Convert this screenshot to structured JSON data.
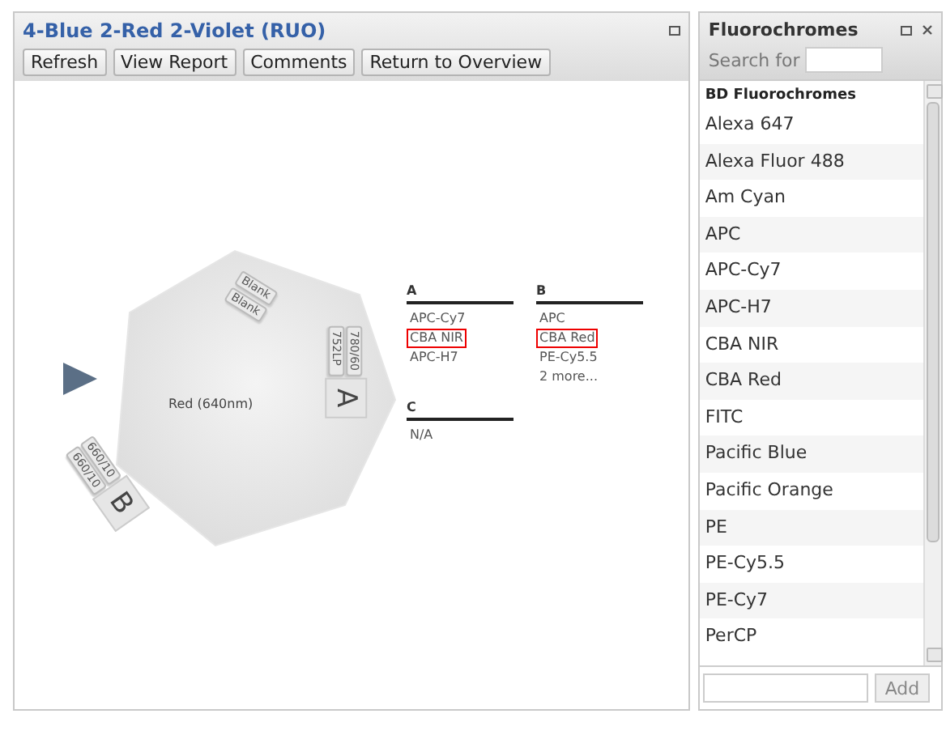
{
  "panel": {
    "title": "4-Blue 2-Red 2-Violet (RUO)",
    "buttons": [
      "Refresh",
      "View Report",
      "Comments",
      "Return to Overview"
    ]
  },
  "laser": {
    "name": "Red (640nm)",
    "blank_filters": [
      "Blank",
      "Blank"
    ],
    "detectors": [
      {
        "label": "A",
        "filters": [
          "780/60",
          "752LP"
        ]
      },
      {
        "label": "B",
        "filters": [
          "660/10",
          "660/10"
        ]
      }
    ]
  },
  "channels": [
    {
      "label": "A",
      "entries": [
        {
          "text": "APC-Cy7",
          "highlighted": false
        },
        {
          "text": "CBA NIR",
          "highlighted": true
        },
        {
          "text": "APC-H7",
          "highlighted": false
        }
      ]
    },
    {
      "label": "B",
      "entries": [
        {
          "text": "APC",
          "highlighted": false
        },
        {
          "text": "CBA Red",
          "highlighted": true
        },
        {
          "text": "PE-Cy5.5",
          "highlighted": false
        },
        {
          "text": "2 more...",
          "highlighted": false
        }
      ]
    },
    {
      "label": "C",
      "entries": [
        {
          "text": "N/A",
          "highlighted": false
        }
      ]
    }
  ],
  "fluorochromes": {
    "title": "Fluorochromes",
    "search_label": "Search for",
    "group": "BD Fluorochromes",
    "items": [
      "Alexa 647",
      "Alexa Fluor 488",
      "Am Cyan",
      "APC",
      "APC-Cy7",
      "APC-H7",
      "CBA NIR",
      "CBA Red",
      "FITC",
      "Pacific Blue",
      "Pacific Orange",
      "PE",
      "PE-Cy5.5",
      "PE-Cy7",
      "PerCP"
    ],
    "add_button": "Add"
  }
}
